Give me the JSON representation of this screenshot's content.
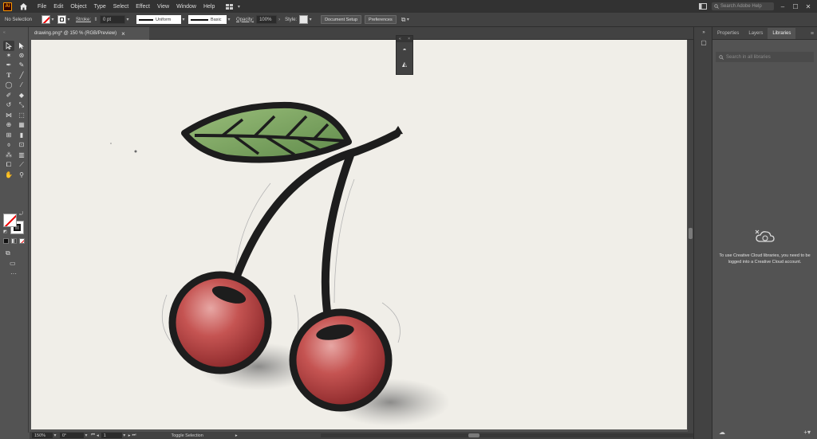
{
  "app": {
    "logo": "Ai"
  },
  "menubar": {
    "items": [
      "File",
      "Edit",
      "Object",
      "Type",
      "Select",
      "Effect",
      "View",
      "Window",
      "Help"
    ],
    "search_placeholder": "Search Adobe Help",
    "icons": [
      "home-icon",
      "workspace-switcher-icon",
      "arrange-documents-icon",
      "search-icon"
    ]
  },
  "controlbar": {
    "selection_label": "No Selection",
    "stroke_label": "Stroke:",
    "stroke_weight": "0 pt",
    "profile_label": "Uniform",
    "brush_label": "Basic",
    "opacity_label": "Opacity:",
    "opacity_value": "100%",
    "style_label": "Style:",
    "document_setup": "Document Setup",
    "preferences": "Preferences"
  },
  "document": {
    "tab_title": "drawing.png* @ 150 % (RGB/Preview)",
    "close_symbol": "×"
  },
  "statusbar": {
    "zoom": "150%",
    "rotation": "0°",
    "artboard_number": "1",
    "toggle_label": "Toggle Selection"
  },
  "right_panel": {
    "tabs": [
      "Properties",
      "Layers",
      "Libraries"
    ],
    "active_tab": "Libraries",
    "search_placeholder": "Search in all libraries",
    "message": "To use Creative Cloud libraries, you need to be logged into a Creative Cloud account."
  },
  "colors": {
    "menubar_bg": "#323232",
    "controlbar_bg": "#424242",
    "workspace_bg": "#535353",
    "artboard_bg": "#f0eee8",
    "accent_logo": "#ff9a00",
    "cherry_red": "#b83a3d",
    "leaf_green": "#6f9a56"
  }
}
